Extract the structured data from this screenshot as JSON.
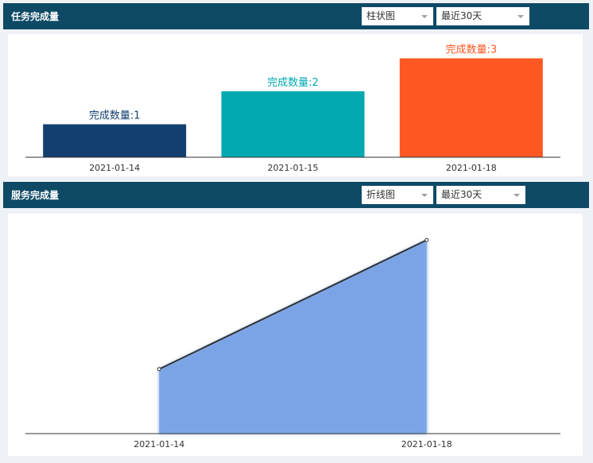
{
  "panels": [
    {
      "title": "任务完成量",
      "chart_type_select": "柱状图",
      "range_select": "最近30天"
    },
    {
      "title": "服务完成量",
      "chart_type_select": "折线图",
      "range_select": "最近30天"
    }
  ],
  "chart_data": [
    {
      "type": "bar",
      "categories": [
        "2021-01-14",
        "2021-01-15",
        "2021-01-18"
      ],
      "values": [
        1,
        2,
        3
      ],
      "data_labels": [
        "完成数量:1",
        "完成数量:2",
        "完成数量:3"
      ],
      "colors": [
        "#123f6e",
        "#03a9b0",
        "#fe5722"
      ],
      "ylim": [
        0,
        3.3
      ]
    },
    {
      "type": "area",
      "categories": [
        "2021-01-14",
        "2021-01-18"
      ],
      "values": [
        1,
        3
      ],
      "line_color": "#333333",
      "fill_color": "#7ba4e6",
      "ylim": [
        0,
        3.2
      ]
    }
  ]
}
